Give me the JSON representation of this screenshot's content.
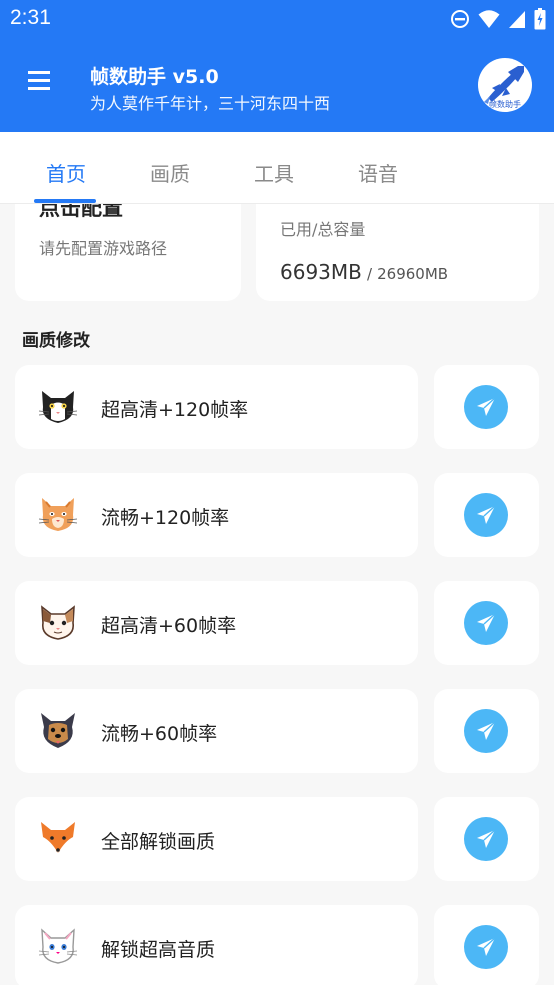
{
  "status": {
    "time": "2:31",
    "icons": [
      "dnd-icon",
      "wifi-icon",
      "signal-icon",
      "battery-icon"
    ]
  },
  "appbar": {
    "title": "帧数助手 v5.0",
    "subtitle": "为人莫作千年计，三十河东四十西",
    "logo_text": "帧数助手",
    "menu_icon": "menu-icon"
  },
  "tabs": [
    {
      "label": "首页",
      "active": true
    },
    {
      "label": "画质",
      "active": false
    },
    {
      "label": "工具",
      "active": false
    },
    {
      "label": "语音",
      "active": false
    }
  ],
  "config_card": {
    "title": "点击配置",
    "desc": "请先配置游戏路径"
  },
  "storage_card": {
    "label": "已用/总容量",
    "used": "6693MB",
    "separator": "/",
    "total": "26960MB"
  },
  "section": {
    "title": "画质修改"
  },
  "items": [
    {
      "label": "超高清+120帧率",
      "icon": "cat-black-white-icon"
    },
    {
      "label": "流畅+120帧率",
      "icon": "cat-orange-icon"
    },
    {
      "label": "超高清+60帧率",
      "icon": "cat-calico-icon"
    },
    {
      "label": "流畅+60帧率",
      "icon": "dog-yorkie-icon"
    },
    {
      "label": "全部解锁画质",
      "icon": "fox-icon"
    },
    {
      "label": "解锁超高音质",
      "icon": "cat-white-icon"
    }
  ],
  "colors": {
    "primary": "#2479f5",
    "send_button": "#4cb7f6",
    "background": "#f7f7f7"
  }
}
